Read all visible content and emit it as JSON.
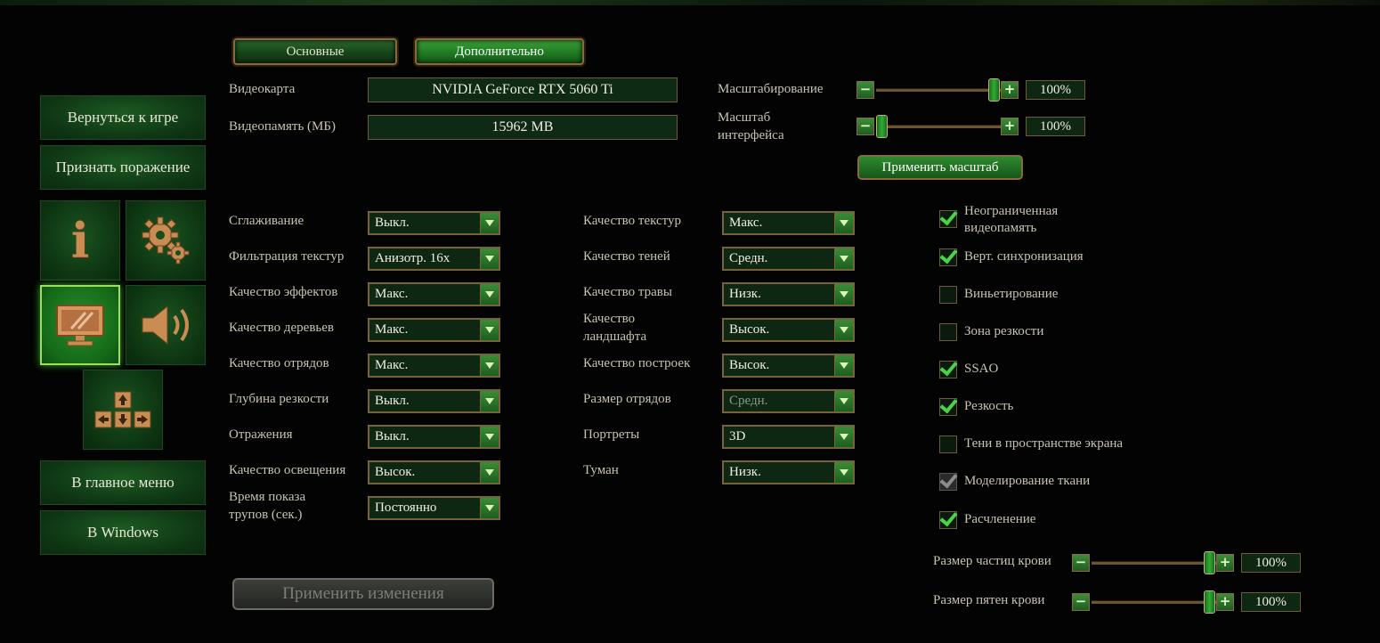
{
  "tabs": [
    {
      "label": "Основные"
    },
    {
      "label": "Дополнительно"
    }
  ],
  "menu": {
    "resume": "Вернуться к игре",
    "surrender": "Признать поражение",
    "main_menu": "В главное меню",
    "windows": "В Windows",
    "tiles": {
      "info_icon": "info-icon",
      "settings_icon": "gears-icon",
      "display_icon": "monitor-icon",
      "sound_icon": "speaker-icon",
      "controls_icon": "arrow-keys-icon",
      "info_glyph": "i"
    }
  },
  "hardware": {
    "gpu_label": "Видеокарта",
    "gpu_value": "NVIDIA GeForce RTX 5060 Ti",
    "vram_label": "Видеопамять (МБ)",
    "vram_value": "15962 MB"
  },
  "scaling": {
    "scale_label": "Масштабирование",
    "scale_value": "100%",
    "scale_fraction": 1.0,
    "ui_scale_label_1": "Масштаб",
    "ui_scale_label_2": "интерфейса",
    "ui_scale_value": "100%",
    "ui_scale_fraction": 0.0,
    "apply_label": "Применить масштаб"
  },
  "settings_left": [
    {
      "label": "Сглаживание",
      "value": "Выкл."
    },
    {
      "label": "Фильтрация текстур",
      "value": "Анизотр. 16x"
    },
    {
      "label": "Качество эффектов",
      "value": "Макс."
    },
    {
      "label": "Качество деревьев",
      "value": "Макс."
    },
    {
      "label": "Качество отрядов",
      "value": "Макс."
    },
    {
      "label": "Глубина резкости",
      "value": "Выкл."
    },
    {
      "label": "Отражения",
      "value": "Выкл."
    },
    {
      "label": "Качество освещения",
      "value": "Высок."
    },
    {
      "label": "Время показа",
      "label2": "трупов (сек.)",
      "value": "Постоянно"
    }
  ],
  "settings_mid": [
    {
      "label": "Качество текстур",
      "value": "Макс."
    },
    {
      "label": "Качество теней",
      "value": "Средн."
    },
    {
      "label": "Качество травы",
      "value": "Низк."
    },
    {
      "label": "Качество",
      "label2": "ландшафта",
      "value": "Высок."
    },
    {
      "label": "Качество построек",
      "value": "Высок."
    },
    {
      "label": "Размер отрядов",
      "value": "Средн.",
      "disabled": true
    },
    {
      "label": "Портреты",
      "value": "3D"
    },
    {
      "label": "Туман",
      "value": "Низк."
    }
  ],
  "checkboxes": [
    {
      "label": "Неограниченная",
      "label2": "видеопамять",
      "checked": true
    },
    {
      "label": "Верт. синхронизация",
      "checked": true
    },
    {
      "label": "Виньетирование",
      "checked": false
    },
    {
      "label": "Зона резкости",
      "checked": false
    },
    {
      "label": "SSAO",
      "checked": true
    },
    {
      "label": "Резкость",
      "checked": true
    },
    {
      "label": "Тени в пространстве экрана",
      "checked": false
    },
    {
      "label": "Моделирование ткани",
      "checked": true,
      "disabled": true
    },
    {
      "label": "Расчленение",
      "checked": true
    }
  ],
  "blood": {
    "particles_label": "Размер частиц крови",
    "particles_value": "100%",
    "particles_fraction": 1.0,
    "stains_label": "Размер пятен крови",
    "stains_value": "100%",
    "stains_fraction": 1.0
  },
  "apply_changes": "Применить изменения",
  "colors": {
    "accent_green": "#2fae31",
    "frame_bronze": "#8a6a3c"
  }
}
